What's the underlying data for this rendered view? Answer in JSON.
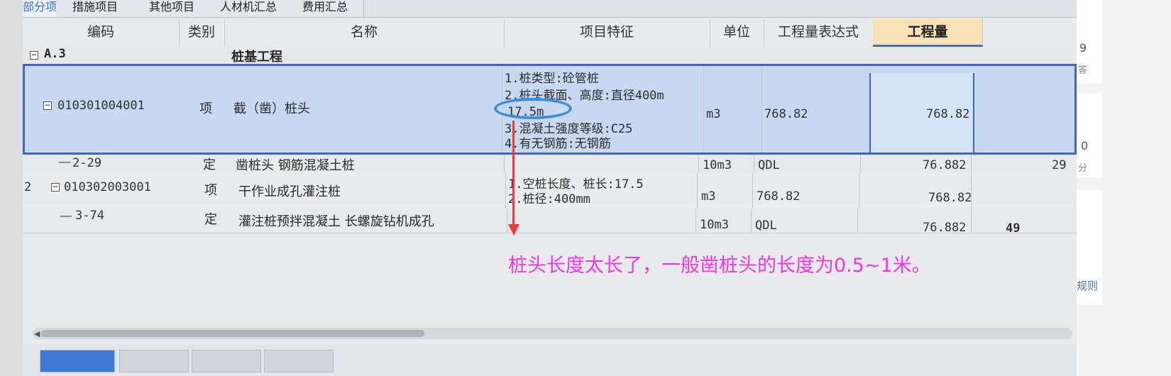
{
  "tabs": [
    "部分项",
    "措施项目",
    "其他项目",
    "人材机汇总",
    "费用汇总"
  ],
  "columns": {
    "code": "编码",
    "category": "类别",
    "name": "名称",
    "features": "项目特征",
    "unit": "单位",
    "quantity_expr": "工程量表达式",
    "quantity": "工程量"
  },
  "group": {
    "code": "A.3",
    "name": "桩基工程"
  },
  "rows": [
    {
      "code": "010301004001",
      "category": "项",
      "name": "截（凿）桩头",
      "features": [
        "1.桩类型:砼管桩",
        "2.桩头截面、高度:直径400m",
        "17.5m",
        "3.混凝土强度等级:C25",
        "4.有无钢筋:无钢筋"
      ],
      "unit": "m3",
      "quantity_expr": "768.82",
      "quantity": "768.82"
    },
    {
      "code": "2-29",
      "category": "定",
      "name": "凿桩头 钢筋混凝土桩",
      "unit": "10m3",
      "quantity_expr": "QDL",
      "quantity": "76.882",
      "extra": "29"
    },
    {
      "index": "2",
      "code": "010302003001",
      "category": "项",
      "name": "干作业成孔灌注桩",
      "features": [
        "1.空桩长度、桩长:17.5",
        "2.桩径:400mm"
      ],
      "unit": "m3",
      "quantity_expr": "768.82",
      "quantity": "768.82"
    },
    {
      "code": "3-74",
      "category": "定",
      "name": "灌注桩预拌混凝土 长螺旋钻机成孔",
      "unit": "10m3",
      "quantity_expr": "QDL",
      "quantity": "76.882",
      "extra": "49"
    }
  ],
  "annotation": {
    "note": "桩头长度太长了，一般凿桩头的长度为0.5~1米。",
    "circle_color": "#3d8ee0",
    "arrow_color": "#ee3a3a",
    "note_color": "#ee36e6"
  },
  "right_panel": {
    "items": [
      "9",
      "答",
      "0",
      "分",
      "规则"
    ]
  },
  "colors": {
    "selection_border": "#3f67c1",
    "selection_fill": "#c7d8f0",
    "header_highlight": "#f7e1b6"
  }
}
